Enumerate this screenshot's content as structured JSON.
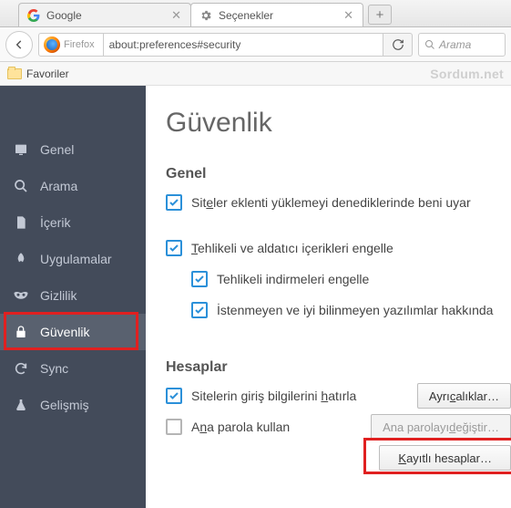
{
  "tabs": {
    "google": "Google",
    "options": "Seçenekler"
  },
  "urlbar": {
    "identity": "Firefox",
    "url": "about:preferences#security"
  },
  "search_placeholder": "Arama",
  "bookmarks": {
    "favorites": "Favoriler"
  },
  "watermark": "Sordum.net",
  "sidebar": {
    "general": "Genel",
    "search": "Arama",
    "content": "İçerik",
    "applications": "Uygulamalar",
    "privacy": "Gizlilik",
    "security": "Güvenlik",
    "sync": "Sync",
    "advanced": "Gelişmiş"
  },
  "page": {
    "title": "Güvenlik",
    "section_general": "Genel",
    "warn_addon_prefix": "Sit",
    "warn_addon_u": "e",
    "warn_addon_suffix": "ler eklenti yüklemeyi denediklerinde beni uyar",
    "block_danger_u": "T",
    "block_danger_suffix": "ehlikeli ve aldatıcı içerikleri engelle",
    "block_downloads": "Tehlikeli indirmeleri engelle",
    "block_unwanted": "İstenmeyen ve iyi bilinmeyen yazılımlar hakkında",
    "section_passwords": "Hesaplar",
    "remember_prefix": "Sitelerin giriş bilgilerini ",
    "remember_u": "h",
    "remember_suffix": "atırla",
    "master_prefix": "A",
    "master_u": "n",
    "master_suffix": "a parola kullan",
    "btn_exceptions_prefix": "Ayrı",
    "btn_exceptions_u": "c",
    "btn_exceptions_suffix": "alıklar…",
    "btn_change_master_prefix": "Ana parolayı ",
    "btn_change_master_u": "d",
    "btn_change_master_suffix": "eğiştir…",
    "btn_saved_u": "K",
    "btn_saved_suffix": "ayıtlı hesaplar…"
  }
}
